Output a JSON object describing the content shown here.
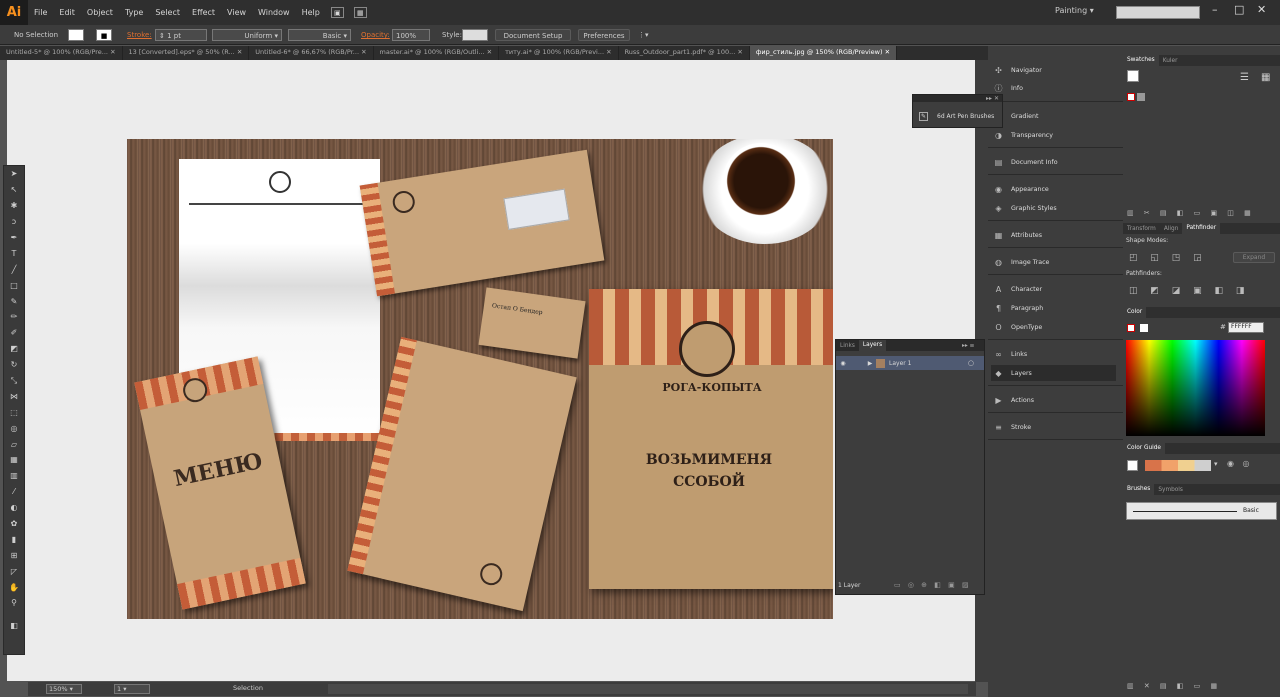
{
  "app": {
    "logo": "Ai",
    "workspace": "Painting"
  },
  "menu": [
    "File",
    "Edit",
    "Object",
    "Type",
    "Select",
    "Effect",
    "View",
    "Window",
    "Help"
  ],
  "control": {
    "selection": "No Selection",
    "stroke_label": "Stroke:",
    "stroke_weight": "1 pt",
    "stroke_profile": "Uniform",
    "brush": "Basic",
    "opacity_label": "Opacity:",
    "opacity": "100%",
    "style_label": "Style:",
    "doc_setup": "Document Setup",
    "preferences": "Preferences"
  },
  "tabs": [
    "Untitled-5* @ 100% (RGB/Pre...",
    "13 [Converted].eps* @ 50% (R...",
    "Untitled-6* @ 66,67% (RGB/Pr...",
    "master.ai* @ 100% (RGB/Outli...",
    "титу.ai* @ 100% (RGB/Previ...",
    "Russ_Outdoor_part1.pdf* @ 100...",
    "фир_стиль.jpg @ 150% (RGB/Preview)"
  ],
  "status": {
    "zoom": "150%",
    "page": "1",
    "tool": "Selection"
  },
  "dock1": [
    {
      "icon": "navigator-icon",
      "label": "Navigator"
    },
    {
      "icon": "info-icon",
      "label": "Info"
    },
    {
      "icon": "gradient-icon",
      "label": "Gradient"
    },
    {
      "icon": "transparency-icon",
      "label": "Transparency"
    },
    {
      "icon": "document-info-icon",
      "label": "Document Info"
    },
    {
      "icon": "appearance-icon",
      "label": "Appearance"
    },
    {
      "icon": "graphic-styles-icon",
      "label": "Graphic Styles"
    },
    {
      "icon": "attributes-icon",
      "label": "Attributes"
    },
    {
      "icon": "image-trace-icon",
      "label": "Image Trace"
    },
    {
      "icon": "character-icon",
      "label": "Character"
    },
    {
      "icon": "paragraph-icon",
      "label": "Paragraph"
    },
    {
      "icon": "opentype-icon",
      "label": "OpenType"
    },
    {
      "icon": "links-icon",
      "label": "Links"
    },
    {
      "icon": "layers-icon",
      "label": "Layers"
    },
    {
      "icon": "actions-icon",
      "label": "Actions"
    },
    {
      "icon": "stroke-icon",
      "label": "Stroke"
    }
  ],
  "swatches": {
    "tabs": [
      "Swatches",
      "Kuler"
    ]
  },
  "pathfinder": {
    "tabs": [
      "Transform",
      "Align",
      "Pathfinder"
    ],
    "shape_modes": "Shape Modes:",
    "pathfinders": "Pathfinders:",
    "expand": "Expand"
  },
  "color": {
    "tab": "Color",
    "hex": "FFFFFF"
  },
  "color_guide": {
    "tab": "Color Guide"
  },
  "brushes": {
    "tabs": [
      "Brushes",
      "Symbols"
    ],
    "basic": "Basic"
  },
  "layers": {
    "tabs": [
      "Links",
      "Layers"
    ],
    "layer1": "Layer 1",
    "count": "1 Layer"
  },
  "art_pen": {
    "label": "6d Art Pen Brushes"
  },
  "artwork": {
    "menu_word": "МЕНЮ",
    "logo": "РОГА-КОПЫТА",
    "card": "Остап О Бендер",
    "bag_slogan": "ВОЗЬМИМЕНЯ ССОБОЙ"
  },
  "colors": {
    "accent": "#f7901e",
    "canvas": "#ececec",
    "panel": "#3d3d3d"
  }
}
